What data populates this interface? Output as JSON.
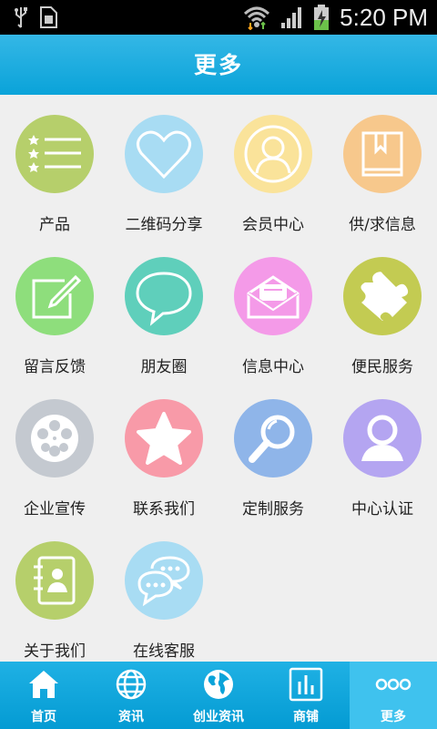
{
  "status": {
    "time": "5:20 PM"
  },
  "header": {
    "title": "更多"
  },
  "grid": {
    "items": [
      {
        "label": "产品",
        "icon": "product-list-icon",
        "color": "#b6cf6b"
      },
      {
        "label": "二维码分享",
        "icon": "heart-icon",
        "color": "#a8dcf3"
      },
      {
        "label": "会员中心",
        "icon": "member-avatar-icon",
        "color": "#fae39a"
      },
      {
        "label": "供/求信息",
        "icon": "book-icon",
        "color": "#f7c88c"
      },
      {
        "label": "留言反馈",
        "icon": "edit-note-icon",
        "color": "#8ede7c"
      },
      {
        "label": "朋友圈",
        "icon": "chat-bubble-icon",
        "color": "#5fcfbb"
      },
      {
        "label": "信息中心",
        "icon": "envelope-icon",
        "color": "#f49ae8"
      },
      {
        "label": "便民服务",
        "icon": "puzzle-icon",
        "color": "#c3cb52"
      },
      {
        "label": "企业宣传",
        "icon": "film-reel-icon",
        "color": "#c4c9d0"
      },
      {
        "label": "联系我们",
        "icon": "star-icon",
        "color": "#f89aa8"
      },
      {
        "label": "定制服务",
        "icon": "magnifier-icon",
        "color": "#8fb5e9"
      },
      {
        "label": "中心认证",
        "icon": "user-icon",
        "color": "#b4a5f1"
      },
      {
        "label": "关于我们",
        "icon": "contacts-book-icon",
        "color": "#b6cf6b"
      },
      {
        "label": "在线客服",
        "icon": "chat-bubbles-icon",
        "color": "#a8dcf3"
      }
    ]
  },
  "tabs": [
    {
      "label": "首页",
      "icon": "home-icon"
    },
    {
      "label": "资讯",
      "icon": "globe-icon"
    },
    {
      "label": "创业资讯",
      "icon": "earth-icon"
    },
    {
      "label": "商铺",
      "icon": "bar-chart-icon"
    },
    {
      "label": "更多",
      "icon": "more-dots-icon",
      "active": true
    }
  ]
}
